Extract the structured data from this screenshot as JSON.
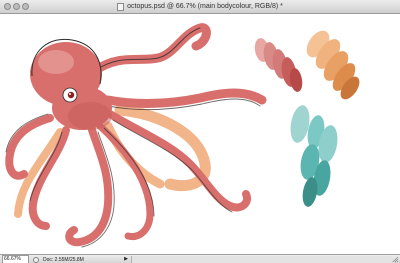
{
  "window": {
    "title": "octopus.psd @ 66.7% (main bodycolour, RGB/8) *"
  },
  "statusbar": {
    "zoom": "66.67%",
    "doc_info": "Doc: 2.55M/25.8M",
    "menu_arrow": "▶"
  },
  "colors": {
    "octopus_body": "#d86f6c",
    "octopus_shadow": "#c65c5a",
    "octopus_highlight": "#e8a19c",
    "underside": "#f2b58a",
    "outline": "#2b2b2b",
    "swatch_reds": [
      "#e8a7a2",
      "#d98a86",
      "#d27b78",
      "#c75d5a",
      "#b54a48"
    ],
    "swatch_oranges": [
      "#f4c295",
      "#f0b27f",
      "#e8a065",
      "#dd8c4c",
      "#c9763a"
    ],
    "swatch_teals": [
      "#9fd4d1",
      "#7cc8c4",
      "#5bb5b0",
      "#48a59f",
      "#3b8f88"
    ]
  },
  "icons": {
    "doc": "document-icon",
    "status": "status-circle-icon",
    "arrow": "triangle-right-icon",
    "grip": "resize-grip-icon"
  }
}
